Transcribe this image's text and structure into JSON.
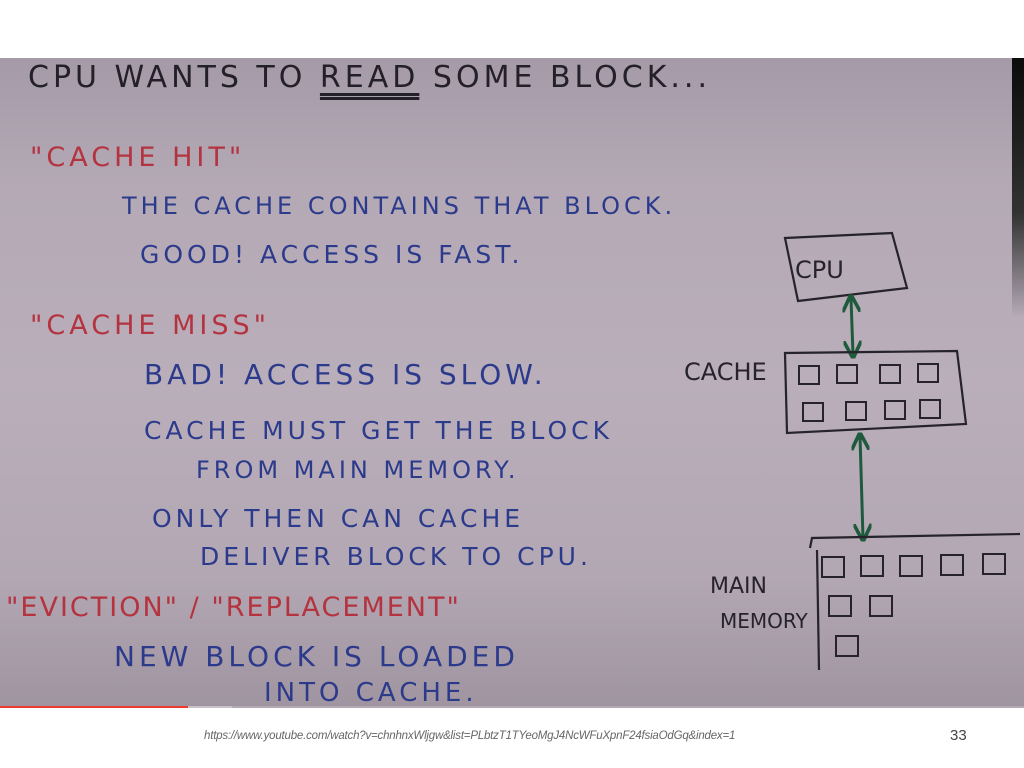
{
  "slide": {
    "page_number": "33",
    "source_url": "https://www.youtube.com/watch?v=chnhnxWljgw&list=PLbtzT1TYeoMgJ4NcWFuXpnF24fsiaOdGq&index=1"
  },
  "video": {
    "played_fraction": 0.184,
    "buffered_fraction": 0.227,
    "colors": {
      "played": "#ee3a2c",
      "buffered": "#c9c3c9"
    }
  },
  "whiteboard": {
    "heading": {
      "prefix": "CPU WANTS TO",
      "emphasis": "READ",
      "suffix": "SOME BLOCK..."
    },
    "cache_hit": {
      "title": "\"CACHE HIT\"",
      "lines": [
        "THE CACHE CONTAINS THAT BLOCK.",
        "GOOD! ACCESS IS FAST."
      ]
    },
    "cache_miss": {
      "title": "\"CACHE MISS\"",
      "lines": [
        "BAD! ACCESS IS SLOW.",
        "CACHE MUST GET THE BLOCK",
        "FROM MAIN MEMORY.",
        "ONLY THEN CAN CACHE",
        "DELIVER BLOCK TO CPU."
      ]
    },
    "eviction": {
      "title": "\"EVICTION\" / \"REPLACEMENT\"",
      "lines": [
        "NEW BLOCK IS LOADED",
        "INTO CACHE."
      ]
    },
    "colors": {
      "heading": "#23202a",
      "term": "#b4333f",
      "body": "#2c3a8c",
      "arrow": "#1f5a3c"
    }
  },
  "diagram": {
    "cpu_label": "CPU",
    "cache_label": "CACHE",
    "memory_label_line1": "MAIN",
    "memory_label_line2": "MEMORY",
    "cache_blocks": 8,
    "memory_blocks": 8
  }
}
